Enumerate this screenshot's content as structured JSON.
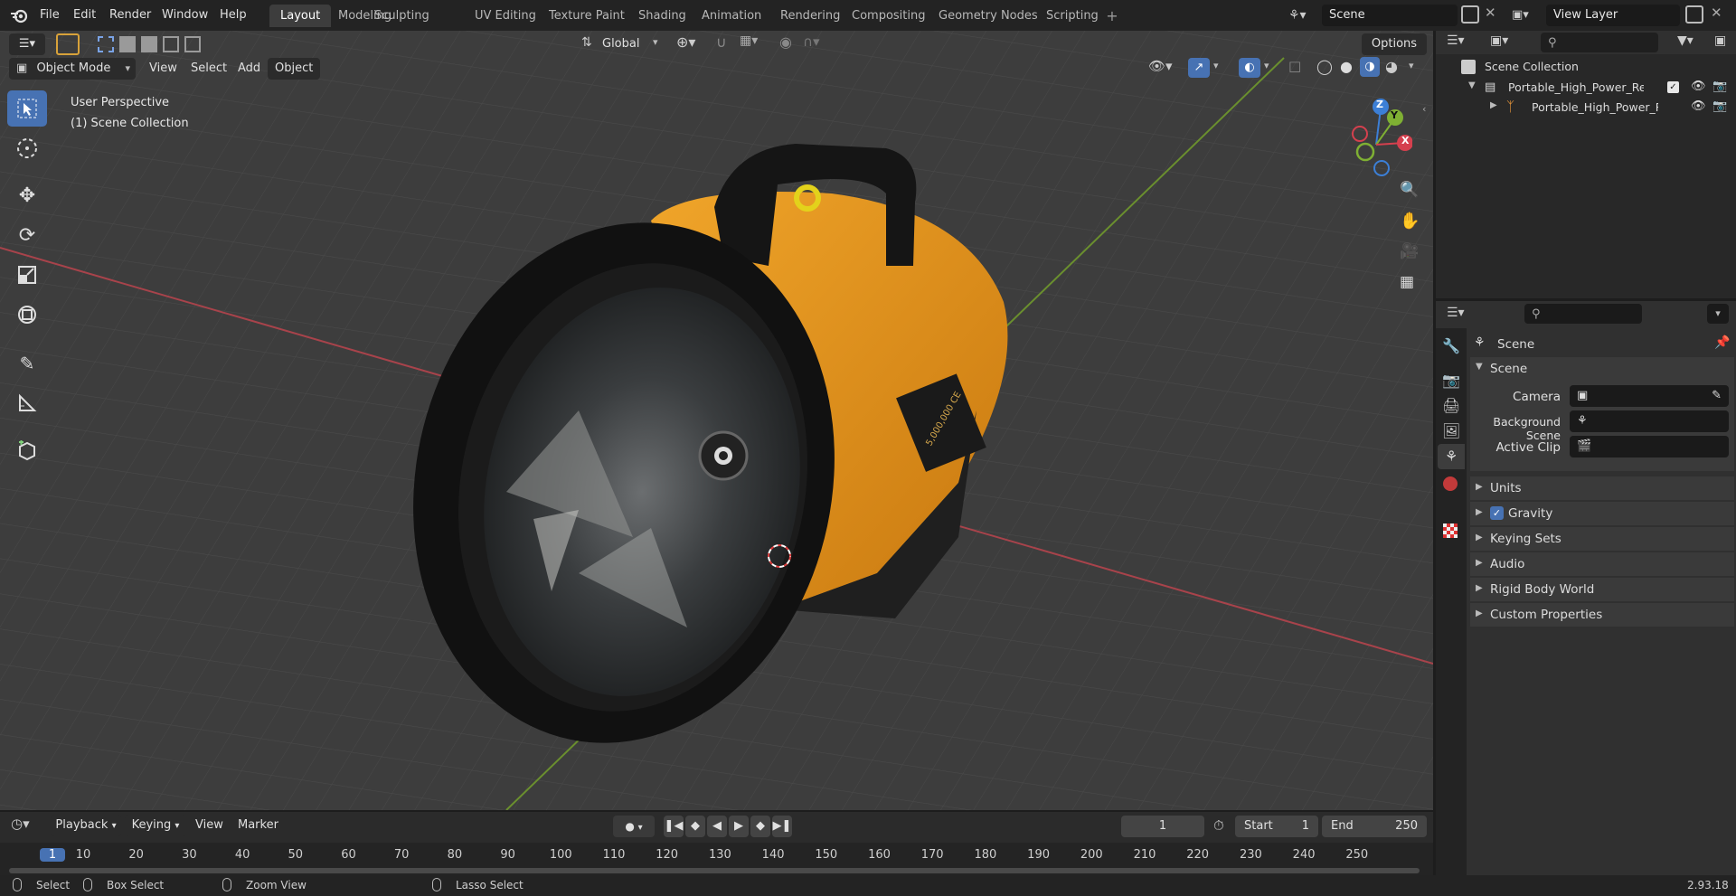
{
  "menus": [
    "File",
    "Edit",
    "Render",
    "Window",
    "Help"
  ],
  "workspaces": [
    "Layout",
    "Modeling",
    "Sculpting",
    "UV Editing",
    "Texture Paint",
    "Shading",
    "Animation",
    "Rendering",
    "Compositing",
    "Geometry Nodes",
    "Scripting"
  ],
  "scene_field": "Scene",
  "view_layer_field": "View Layer",
  "viewport": {
    "orientation": "Global",
    "options_label": "Options",
    "mode": "Object Mode",
    "header_menus": [
      "View",
      "Select",
      "Add",
      "Object"
    ],
    "overlay_line1": "User Perspective",
    "overlay_line2": "(1) Scene Collection",
    "label_text": "5,000,000 CE",
    "gizmo_axes": [
      "Z",
      "Y",
      "X"
    ]
  },
  "outliner": {
    "root": "Scene Collection",
    "items": [
      "Portable_High_Power_Rechar",
      "Portable_High_Power_Re"
    ]
  },
  "properties": {
    "context_title": "Scene",
    "section_scene": "Scene",
    "fields": [
      "Camera",
      "Background Scene",
      "Active Clip"
    ],
    "sections": [
      "Units",
      "Gravity",
      "Keying Sets",
      "Audio",
      "Rigid Body World",
      "Custom Properties"
    ],
    "gravity_checked": true
  },
  "timeline": {
    "menus": [
      "Playback",
      "Keying",
      "View",
      "Marker"
    ],
    "current_frame": "1",
    "start_label": "Start",
    "start_value": "1",
    "end_label": "End",
    "end_value": "250",
    "ticks": [
      "1",
      "10",
      "20",
      "30",
      "40",
      "50",
      "60",
      "70",
      "80",
      "90",
      "100",
      "110",
      "120",
      "130",
      "140",
      "150",
      "160",
      "170",
      "180",
      "190",
      "200",
      "210",
      "220",
      "230",
      "240",
      "250"
    ]
  },
  "statusbar": {
    "items": [
      "Select",
      "Box Select",
      "Zoom View",
      "Lasso Select"
    ],
    "version": "2.93.18"
  },
  "colors": {
    "accent": "#4772b3",
    "flashlight_body": "#e8961e",
    "axis_x": "#d5404e",
    "axis_y": "#7fb033",
    "axis_z": "#3c7fd6"
  }
}
